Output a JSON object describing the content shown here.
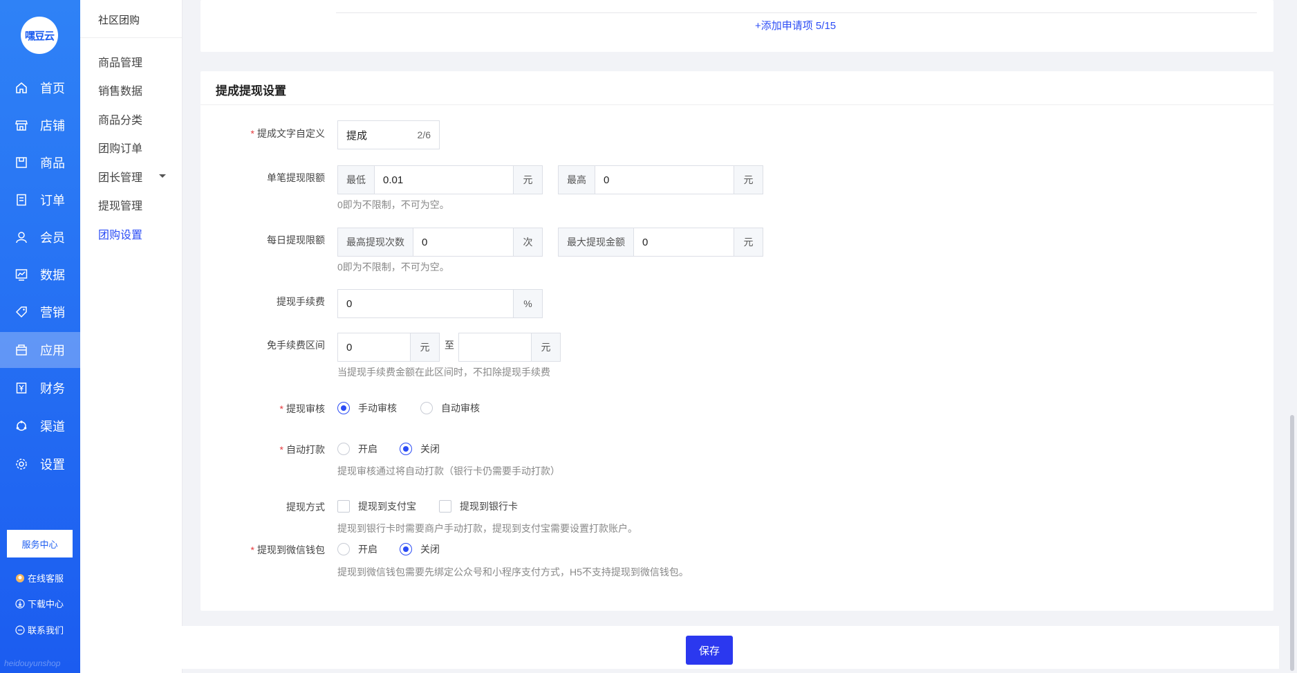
{
  "app": {
    "logo_text": "嘿豆云",
    "watermark": "heidouyunshop"
  },
  "sidebar": {
    "items": [
      {
        "label": "首页",
        "icon": "home-icon"
      },
      {
        "label": "店铺",
        "icon": "store-icon"
      },
      {
        "label": "商品",
        "icon": "goods-icon"
      },
      {
        "label": "订单",
        "icon": "order-icon"
      },
      {
        "label": "会员",
        "icon": "member-icon"
      },
      {
        "label": "数据",
        "icon": "data-icon"
      },
      {
        "label": "营销",
        "icon": "marketing-tag-icon"
      },
      {
        "label": "应用",
        "icon": "app-icon",
        "active": true
      },
      {
        "label": "财务",
        "icon": "finance-icon"
      },
      {
        "label": "渠道",
        "icon": "channel-icon"
      },
      {
        "label": "设置",
        "icon": "settings-icon"
      }
    ],
    "service_center": "服务中心",
    "footer_links": [
      {
        "label": "在线客服",
        "icon": "customer-service-icon"
      },
      {
        "label": "下载中心",
        "icon": "download-icon"
      },
      {
        "label": "联系我们",
        "icon": "contact-icon"
      }
    ]
  },
  "submenu": {
    "title": "社区团购",
    "items": [
      {
        "label": "商品管理"
      },
      {
        "label": "销售数据"
      },
      {
        "label": "商品分类"
      },
      {
        "label": "团购订单"
      },
      {
        "label": "团长管理",
        "has_caret": true
      },
      {
        "label": "提现管理"
      },
      {
        "label": "团购设置",
        "active": true
      }
    ]
  },
  "top_card": {
    "add_link": "+添加申请项 5/15"
  },
  "withdraw": {
    "section_title": "提成提现设置",
    "commission_text": {
      "label": "提成文字自定义",
      "value": "提成",
      "counter": "2/6"
    },
    "single_limit": {
      "label": "单笔提现限额",
      "min_prefix": "最低",
      "min_value": "0.01",
      "min_unit": "元",
      "max_prefix": "最高",
      "max_value": "0",
      "max_unit": "元",
      "hint": "0即为不限制，不可为空。"
    },
    "daily_limit": {
      "label": "每日提现限额",
      "count_prefix": "最高提现次数",
      "count_value": "0",
      "count_unit": "次",
      "amount_prefix": "最大提现金额",
      "amount_value": "0",
      "amount_unit": "元",
      "hint": "0即为不限制，不可为空。"
    },
    "fee": {
      "label": "提现手续费",
      "value": "0",
      "unit": "%"
    },
    "free_range": {
      "label": "免手续费区间",
      "from_value": "0",
      "from_unit": "元",
      "to_text": "至",
      "to_value": "",
      "to_unit": "元",
      "hint": "当提现手续费金额在此区间时，不扣除提现手续费"
    },
    "review": {
      "label": "提现审核",
      "options": [
        "手动审核",
        "自动审核"
      ],
      "selected": 0
    },
    "auto_pay": {
      "label": "自动打款",
      "options": [
        "开启",
        "关闭"
      ],
      "selected": 1,
      "hint": "提现审核通过将自动打款（银行卡仍需要手动打款）"
    },
    "method": {
      "label": "提现方式",
      "options": [
        "提现到支付宝",
        "提现到银行卡"
      ],
      "hint": "提现到银行卡时需要商户手动打款，提现到支付宝需要设置打款账户。"
    },
    "wechat": {
      "label": "提现到微信钱包",
      "options": [
        "开启",
        "关闭"
      ],
      "selected": 1,
      "hint": "提现到微信钱包需要先绑定公众号和小程序支付方式，H5不支持提现到微信钱包。"
    }
  },
  "save_button": "保存",
  "colors": {
    "primary": "#2b4cf5",
    "sidebar_top": "#2f82f6",
    "sidebar_bottom": "#1b5cf0",
    "required": "#e4393c"
  }
}
